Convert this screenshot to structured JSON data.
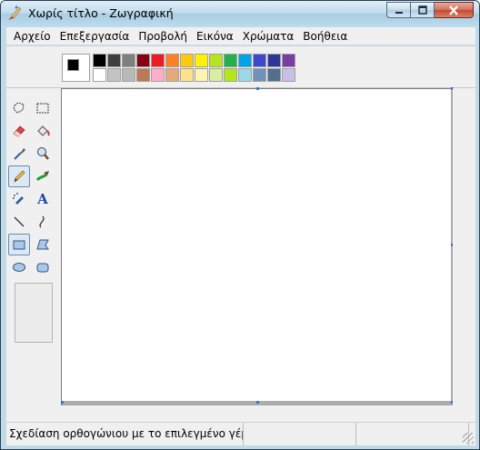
{
  "window": {
    "title": "Χωρίς τίτλο - Ζωγραφική",
    "app_icon": "paint-brush-icon"
  },
  "menu": [
    {
      "label": "Αρχείο"
    },
    {
      "label": "Επεξεργασία"
    },
    {
      "label": "Προβολή"
    },
    {
      "label": "Εικόνα"
    },
    {
      "label": "Χρώματα"
    },
    {
      "label": "Βοήθεια"
    }
  ],
  "colors": {
    "foreground": "#000000",
    "background": "#ffffff",
    "palette_row1": [
      "#000000",
      "#3f3f3f",
      "#7f7f7f",
      "#880015",
      "#ed1c24",
      "#ff7f27",
      "#ffc90e",
      "#fff200",
      "#b5e61d",
      "#22b14c",
      "#00a2e8",
      "#3f48cc",
      "#2f3699",
      "#7a3da4"
    ],
    "palette_row2": [
      "#ffffff",
      "#c3c3c3",
      "#b9b9b9",
      "#b97a57",
      "#ffaec9",
      "#e5aa7a",
      "#ffe28a",
      "#fff5b0",
      "#d6f0a0",
      "#b5e61d",
      "#99d9ea",
      "#7092be",
      "#546d8e",
      "#c8bfe7"
    ]
  },
  "tools": [
    {
      "name": "free-form-select-icon"
    },
    {
      "name": "select-icon"
    },
    {
      "name": "eraser-icon"
    },
    {
      "name": "fill-bucket-icon"
    },
    {
      "name": "color-picker-icon"
    },
    {
      "name": "magnifier-icon"
    },
    {
      "name": "pencil-icon"
    },
    {
      "name": "brush-icon"
    },
    {
      "name": "airbrush-icon"
    },
    {
      "name": "text-icon",
      "glyph": "A"
    },
    {
      "name": "line-icon"
    },
    {
      "name": "curve-icon"
    },
    {
      "name": "rectangle-icon"
    },
    {
      "name": "polygon-icon"
    },
    {
      "name": "ellipse-icon"
    },
    {
      "name": "rounded-rectangle-icon"
    }
  ],
  "status": {
    "text": "Σχεδίαση ορθογώνιου με το επιλεγμένο γέμισμα."
  }
}
